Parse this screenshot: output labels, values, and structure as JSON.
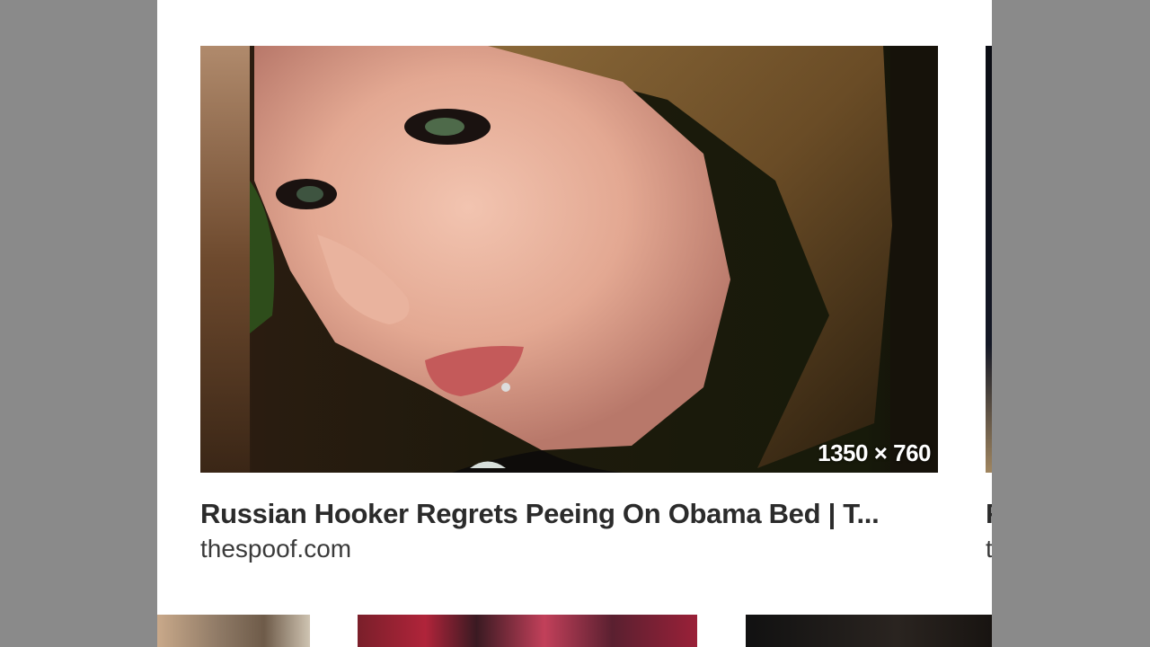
{
  "results": [
    {
      "image_alt": "Close-up portrait of a young woman with freckles and a lip piercing",
      "dimensions": "1350 × 760",
      "title": "Russian Hooker Regrets Peeing On Obama Bed | T...",
      "source": "thespoof.com"
    },
    {
      "title_partial": "F",
      "source_partial": "t"
    }
  ]
}
